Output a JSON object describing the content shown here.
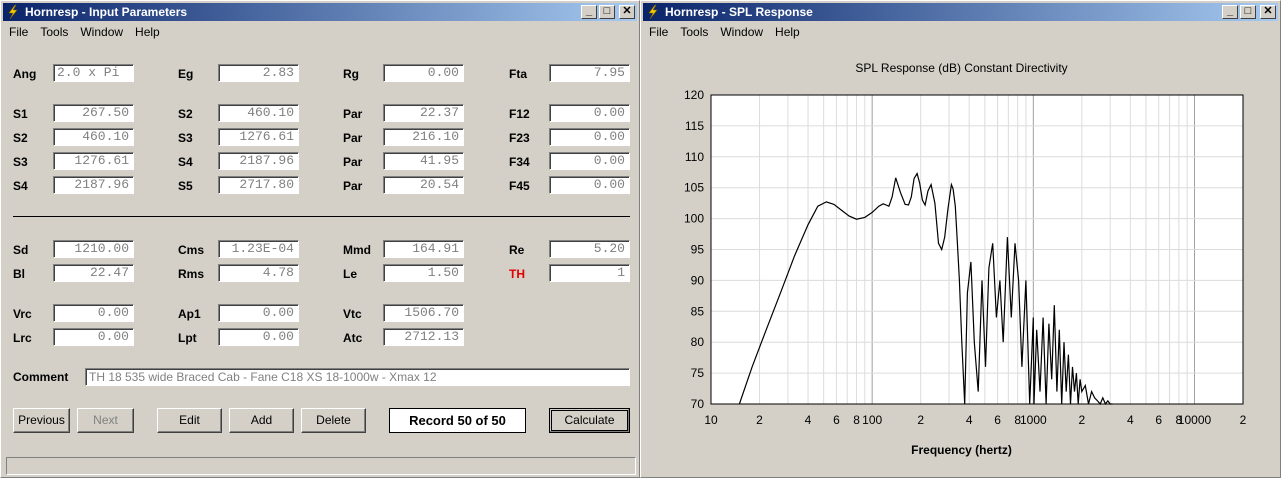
{
  "left_window": {
    "title": "Hornresp - Input Parameters",
    "menu": [
      "File",
      "Tools",
      "Window",
      "Help"
    ],
    "rows": [
      [
        {
          "label": "Ang",
          "value": "2.0 x Pi",
          "align": "left"
        },
        {
          "label": "Eg",
          "value": "2.83"
        },
        {
          "label": "Rg",
          "value": "0.00"
        },
        {
          "label": "Fta",
          "value": "7.95"
        }
      ],
      [
        {
          "label": "S1",
          "value": "267.50"
        },
        {
          "label": "S2",
          "value": "460.10"
        },
        {
          "label": "Par",
          "value": "22.37"
        },
        {
          "label": "F12",
          "value": "0.00"
        }
      ],
      [
        {
          "label": "S2",
          "value": "460.10"
        },
        {
          "label": "S3",
          "value": "1276.61"
        },
        {
          "label": "Par",
          "value": "216.10"
        },
        {
          "label": "F23",
          "value": "0.00"
        }
      ],
      [
        {
          "label": "S3",
          "value": "1276.61"
        },
        {
          "label": "S4",
          "value": "2187.96"
        },
        {
          "label": "Par",
          "value": "41.95"
        },
        {
          "label": "F34",
          "value": "0.00"
        }
      ],
      [
        {
          "label": "S4",
          "value": "2187.96"
        },
        {
          "label": "S5",
          "value": "2717.80"
        },
        {
          "label": "Par",
          "value": "20.54"
        },
        {
          "label": "F45",
          "value": "0.00"
        }
      ],
      [
        {
          "label": "Sd",
          "value": "1210.00"
        },
        {
          "label": "Cms",
          "value": "1.23E-04"
        },
        {
          "label": "Mmd",
          "value": "164.91"
        },
        {
          "label": "Re",
          "value": "5.20"
        }
      ],
      [
        {
          "label": "Bl",
          "value": "22.47"
        },
        {
          "label": "Rms",
          "value": "4.78"
        },
        {
          "label": "Le",
          "value": "1.50"
        },
        {
          "label": "TH",
          "value": "1",
          "red": true
        }
      ],
      [
        {
          "label": "Vrc",
          "value": "0.00"
        },
        {
          "label": "Ap1",
          "value": "0.00"
        },
        {
          "label": "Vtc",
          "value": "1506.70"
        },
        null
      ],
      [
        {
          "label": "Lrc",
          "value": "0.00"
        },
        {
          "label": "Lpt",
          "value": "0.00"
        },
        {
          "label": "Atc",
          "value": "2712.13"
        },
        null
      ]
    ],
    "comment_label": "Comment",
    "comment_value": "TH 18  535 wide Braced Cab - Fane C18 XS 18-1000w - Xmax 12",
    "buttons": {
      "previous": "Previous",
      "next": "Next",
      "edit": "Edit",
      "add": "Add",
      "delete": "Delete",
      "calculate": "Calculate"
    },
    "record": "Record 50 of 50"
  },
  "right_window": {
    "title": "Hornresp - SPL Response",
    "menu": [
      "File",
      "Tools",
      "Window",
      "Help"
    ]
  },
  "chart_data": {
    "type": "line",
    "title": "SPL Response (dB)   Constant Directivity",
    "xlabel": "Frequency (hertz)",
    "ylabel": "",
    "xscale": "log",
    "xlim": [
      10,
      20000
    ],
    "ylim": [
      70,
      120
    ],
    "y_ticks": [
      120,
      115,
      110,
      105,
      100,
      95,
      90,
      85,
      80,
      75,
      70
    ],
    "x_tick_labels": [
      "10",
      "2",
      "4",
      "6",
      "8",
      "100",
      "2",
      "4",
      "6",
      "8",
      "1000",
      "2",
      "4",
      "6",
      "8",
      "10000",
      "2"
    ],
    "grid": true,
    "series": [
      {
        "color": "#000000",
        "x": [
          15,
          18,
          22,
          27,
          33,
          40,
          46,
          52,
          58,
          65,
          72,
          80,
          90,
          100,
          110,
          117,
          122,
          127,
          133,
          140,
          150,
          160,
          168,
          175,
          182,
          190,
          197,
          205,
          213,
          222,
          232,
          245,
          258,
          270,
          282,
          295,
          310,
          318,
          328,
          338,
          348,
          360,
          375,
          390,
          410,
          430,
          455,
          480,
          505,
          530,
          560,
          590,
          620,
          650,
          690,
          730,
          770,
          810,
          850,
          900,
          950,
          1000,
          1010,
          1050,
          1100,
          1150,
          1200,
          1250,
          1300,
          1350,
          1400,
          1450,
          1500,
          1550,
          1600,
          1650,
          1700,
          1750,
          1800,
          1850,
          1900,
          1950,
          2000,
          2100,
          2200,
          2300,
          2400,
          2500,
          2600,
          2700,
          2800,
          2900,
          3000,
          3100
        ],
        "y": [
          70,
          76,
          82,
          88,
          94,
          99,
          102,
          102.7,
          102.3,
          101.3,
          100.4,
          99.9,
          100.2,
          101,
          102,
          102.4,
          102.2,
          102,
          103.5,
          106.6,
          104.2,
          102.3,
          102.2,
          103.5,
          106.5,
          107.3,
          105.8,
          103,
          102.2,
          104.5,
          105.5,
          102.5,
          96,
          95,
          97,
          101.5,
          105.5,
          104.8,
          102,
          96,
          90,
          80,
          70,
          88,
          93,
          80,
          72,
          90,
          76,
          92,
          96,
          84,
          90,
          80,
          97,
          84,
          96,
          90,
          76,
          90,
          70,
          84,
          70,
          82,
          72,
          84,
          70,
          83,
          74,
          86,
          72,
          82,
          70,
          80,
          72,
          78,
          70,
          76,
          72,
          75,
          70,
          74,
          72,
          73,
          70,
          72,
          71,
          70.5,
          70,
          71,
          70,
          70.5,
          70,
          70
        ]
      }
    ]
  }
}
